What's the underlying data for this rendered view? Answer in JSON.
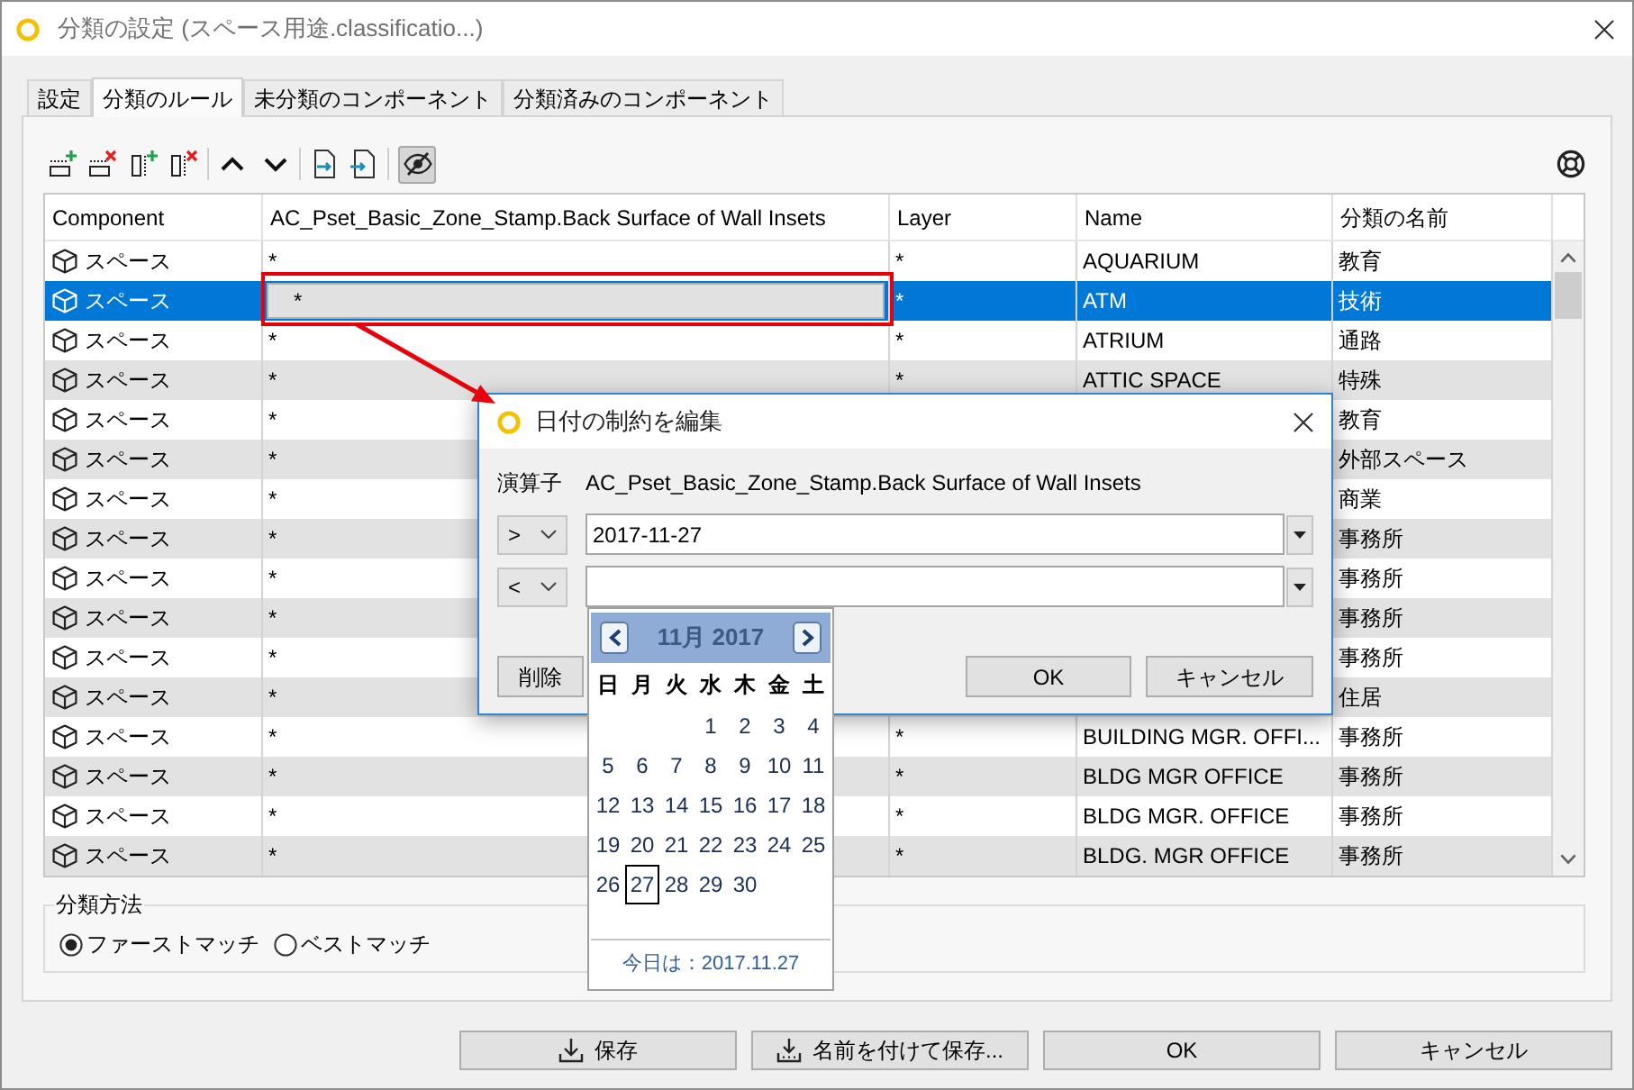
{
  "window": {
    "title": "分類の設定 (スペース用途.classificatio...)"
  },
  "tabs": [
    {
      "label": "設定",
      "selected": false
    },
    {
      "label": "分類のルール",
      "selected": true
    },
    {
      "label": "未分類のコンポーネント",
      "selected": false
    },
    {
      "label": "分類済みのコンポーネント",
      "selected": false
    }
  ],
  "toolbar": {
    "visibility_toggle": {
      "pressed": true
    }
  },
  "table": {
    "columns": [
      "Component",
      "AC_Pset_Basic_Zone_Stamp.Back Surface of Wall Insets",
      "Layer",
      "Name",
      "分類の名前"
    ],
    "rows": [
      {
        "component": "スペース",
        "property": "*",
        "layer": "*",
        "name": "AQUARIUM",
        "classification": "教育",
        "selected": false,
        "editing": false
      },
      {
        "component": "スペース",
        "property": "*",
        "layer": "*",
        "name": "ATM",
        "classification": "技術",
        "selected": true,
        "editing": true
      },
      {
        "component": "スペース",
        "property": "*",
        "layer": "*",
        "name": "ATRIUM",
        "classification": "通路",
        "selected": false,
        "editing": false
      },
      {
        "component": "スペース",
        "property": "*",
        "layer": "*",
        "name": "ATTIC SPACE",
        "classification": "特殊",
        "selected": false,
        "editing": false
      },
      {
        "component": "スペース",
        "property": "*",
        "classification": "教育",
        "selected": false,
        "editing": false
      },
      {
        "component": "スペース",
        "property": "*",
        "classification": "外部スペース",
        "selected": false,
        "editing": false
      },
      {
        "component": "スペース",
        "property": "*",
        "classification": "商業",
        "selected": false,
        "editing": false
      },
      {
        "component": "スペース",
        "property": "*",
        "classification": "事務所",
        "selected": false,
        "editing": false
      },
      {
        "component": "スペース",
        "property": "*",
        "classification": "事務所",
        "selected": false,
        "editing": false
      },
      {
        "component": "スペース",
        "property": "*",
        "classification": "事務所",
        "selected": false,
        "editing": false
      },
      {
        "component": "スペース",
        "property": "*",
        "classification": "事務所",
        "selected": false,
        "editing": false
      },
      {
        "component": "スペース",
        "property": "*",
        "classification": "住居",
        "selected": false,
        "editing": false
      },
      {
        "component": "スペース",
        "property": "*",
        "layer": "*",
        "name": "BUILDING MGR. OFFI...",
        "classification": "事務所",
        "selected": false,
        "editing": false
      },
      {
        "component": "スペース",
        "property": "*",
        "layer": "*",
        "name": "BLDG MGR OFFICE",
        "classification": "事務所",
        "selected": false,
        "editing": false
      },
      {
        "component": "スペース",
        "property": "*",
        "layer": "*",
        "name": "BLDG MGR. OFFICE",
        "classification": "事務所",
        "selected": false,
        "editing": false
      },
      {
        "component": "スペース",
        "property": "*",
        "layer": "*",
        "name": "BLDG. MGR OFFICE",
        "classification": "事務所",
        "selected": false,
        "editing": false
      }
    ]
  },
  "dialog": {
    "title": "日付の制約を編集",
    "operator_label": "演算子",
    "property": "AC_Pset_Basic_Zone_Stamp.Back Surface of Wall Insets",
    "conditions": [
      {
        "operator": ">",
        "value": "2017-11-27"
      },
      {
        "operator": "<"
      }
    ],
    "buttons": [
      {
        "label": "削除",
        "kind": "delete"
      },
      {
        "label": "OK",
        "kind": "ok"
      },
      {
        "label": "キャンセル",
        "kind": "cancel"
      }
    ],
    "calendar": {
      "month": "11月 2017",
      "weekdays": [
        "日",
        "月",
        "火",
        "水",
        "木",
        "金",
        "土"
      ],
      "weeks": [
        {
          "days": [
            {
              "label": "1",
              "selected": false
            },
            {
              "label": "2",
              "selected": false
            },
            {
              "label": "3",
              "selected": false
            },
            {
              "label": "4",
              "selected": false
            }
          ]
        },
        {
          "days": [
            {
              "label": "5",
              "selected": false
            },
            {
              "label": "6",
              "selected": false
            },
            {
              "label": "7",
              "selected": false
            },
            {
              "label": "8",
              "selected": false
            },
            {
              "label": "9",
              "selected": false
            },
            {
              "label": "10",
              "selected": false
            },
            {
              "label": "11",
              "selected": false
            }
          ]
        },
        {
          "days": [
            {
              "label": "12",
              "selected": false
            },
            {
              "label": "13",
              "selected": false
            },
            {
              "label": "14",
              "selected": false
            },
            {
              "label": "15",
              "selected": false
            },
            {
              "label": "16",
              "selected": false
            },
            {
              "label": "17",
              "selected": false
            },
            {
              "label": "18",
              "selected": false
            }
          ]
        },
        {
          "days": [
            {
              "label": "19",
              "selected": false
            },
            {
              "label": "20",
              "selected": false
            },
            {
              "label": "21",
              "selected": false
            },
            {
              "label": "22",
              "selected": false
            },
            {
              "label": "23",
              "selected": false
            },
            {
              "label": "24",
              "selected": false
            },
            {
              "label": "25",
              "selected": false
            }
          ]
        },
        {
          "days": [
            {
              "label": "26",
              "selected": false
            },
            {
              "label": "27",
              "selected": true
            },
            {
              "label": "28",
              "selected": false
            },
            {
              "label": "29",
              "selected": false
            },
            {
              "label": "30",
              "selected": false
            }
          ]
        }
      ],
      "today": "今日は：2017.11.27"
    }
  },
  "classification_method": {
    "legend": "分類方法",
    "options": [
      {
        "label": "ファーストマッチ",
        "selected": true
      },
      {
        "label": "ベストマッチ",
        "selected": false
      }
    ]
  },
  "buttons": [
    {
      "label": "保存",
      "kind": "save"
    },
    {
      "label": "名前を付けて保存...",
      "kind": "save-as"
    },
    {
      "label": "OK",
      "kind": "plain"
    },
    {
      "label": "キャンセル",
      "kind": "plain"
    }
  ]
}
